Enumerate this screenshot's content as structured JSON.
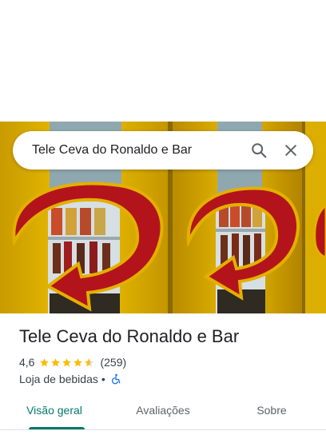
{
  "search": {
    "query": "Tele Ceva do Ronaldo e Bar",
    "search_icon": "search-icon",
    "close_icon": "close-icon"
  },
  "place": {
    "name": "Tele Ceva do Ronaldo e Bar",
    "rating": "4,6",
    "rating_value": 4.6,
    "reviews": "(259)",
    "category": "Loja de bebidas",
    "separator": "•",
    "accessibility_icon": "wheelchair-icon"
  },
  "tabs": [
    {
      "label": "Visão geral",
      "active": true
    },
    {
      "label": "Avaliações",
      "active": false
    },
    {
      "label": "Sobre",
      "active": false
    }
  ],
  "colors": {
    "accent": "#00796b",
    "star": "#fbbc04",
    "accessibility": "#1a73e8",
    "fridge_yellow": "#e2b400",
    "logo_red": "#b3141c"
  }
}
